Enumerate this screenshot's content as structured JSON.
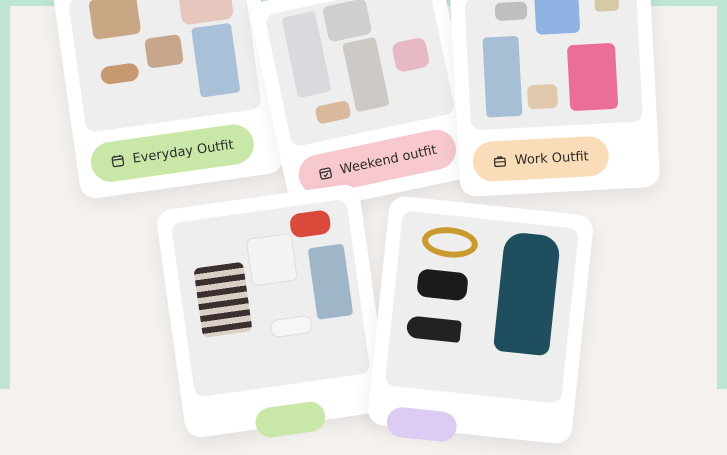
{
  "cards": [
    {
      "label": "Everyday Outfit",
      "icon": "calendar-icon",
      "pill_color": "#c9e8a8"
    },
    {
      "label": "Weekend outfit",
      "icon": "calendar-check-icon",
      "pill_color": "#f7c9cf"
    },
    {
      "label": "Work Outfit",
      "icon": "briefcase-icon",
      "pill_color": "#f9dcb8"
    },
    {
      "label": "",
      "icon": "",
      "pill_color": "#c9e8a8"
    },
    {
      "label": "",
      "icon": "",
      "pill_color": "#dccbf3"
    }
  ],
  "colors": {
    "background": "#f4f1ef",
    "frame": "#bfe6d2",
    "card": "#ffffff",
    "photo": "#eeeeee"
  }
}
